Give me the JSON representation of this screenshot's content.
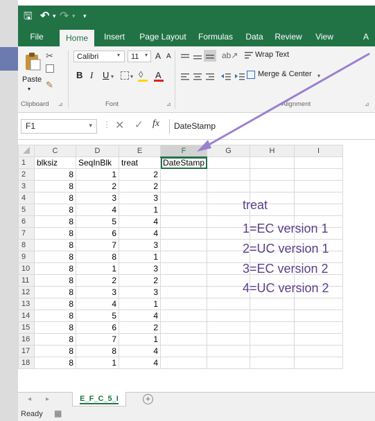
{
  "qat": {
    "save_glyph": "🖫",
    "undo_glyph": "↶",
    "redo_glyph": "↷",
    "more_glyph": "▾"
  },
  "tabs": [
    "File",
    "Home",
    "Insert",
    "Page Layout",
    "Formulas",
    "Data",
    "Review",
    "View",
    "A"
  ],
  "ribbon": {
    "paste": "Paste",
    "font_name": "Calibri",
    "font_size": "11",
    "grow": "A",
    "shrink": "A",
    "bold": "B",
    "italic": "I",
    "underline": "U",
    "wrap_text": "Wrap Text",
    "merge_center": "Merge & Center",
    "groups": {
      "clipboard": "Clipboard",
      "font": "Font",
      "alignment": "Alignment"
    }
  },
  "formula_bar": {
    "name_box": "F1",
    "fx": "fx",
    "content": "DateStamp"
  },
  "columns": [
    "C",
    "D",
    "E",
    "F",
    "G",
    "H",
    "I"
  ],
  "rows": [
    {
      "n": "1",
      "c": "blksiz",
      "d": "SeqInBlk",
      "e": "treat",
      "f": "DateStamp"
    },
    {
      "n": "2",
      "c": "8",
      "d": "1",
      "e": "2"
    },
    {
      "n": "3",
      "c": "8",
      "d": "2",
      "e": "2"
    },
    {
      "n": "4",
      "c": "8",
      "d": "3",
      "e": "3"
    },
    {
      "n": "5",
      "c": "8",
      "d": "4",
      "e": "1"
    },
    {
      "n": "6",
      "c": "8",
      "d": "5",
      "e": "4"
    },
    {
      "n": "7",
      "c": "8",
      "d": "6",
      "e": "4"
    },
    {
      "n": "8",
      "c": "8",
      "d": "7",
      "e": "3"
    },
    {
      "n": "9",
      "c": "8",
      "d": "8",
      "e": "1"
    },
    {
      "n": "10",
      "c": "8",
      "d": "1",
      "e": "3"
    },
    {
      "n": "11",
      "c": "8",
      "d": "2",
      "e": "2"
    },
    {
      "n": "12",
      "c": "8",
      "d": "3",
      "e": "3"
    },
    {
      "n": "13",
      "c": "8",
      "d": "4",
      "e": "1"
    },
    {
      "n": "14",
      "c": "8",
      "d": "5",
      "e": "4"
    },
    {
      "n": "15",
      "c": "8",
      "d": "6",
      "e": "2"
    },
    {
      "n": "16",
      "c": "8",
      "d": "7",
      "e": "1"
    },
    {
      "n": "17",
      "c": "8",
      "d": "8",
      "e": "4"
    },
    {
      "n": "18",
      "c": "8",
      "d": "1",
      "e": "4"
    }
  ],
  "legend": {
    "title": "treat",
    "lines": [
      "1=EC version 1",
      "2=UC version 1",
      "3=EC version 2",
      "4=UC version 2"
    ],
    "color": "#5b3f8a"
  },
  "sheet_tab": "E_F_C_5_I",
  "add_sheet": "+",
  "status": "Ready",
  "colors": {
    "excel_green": "#217346",
    "arrow": "#9b7fd1"
  }
}
